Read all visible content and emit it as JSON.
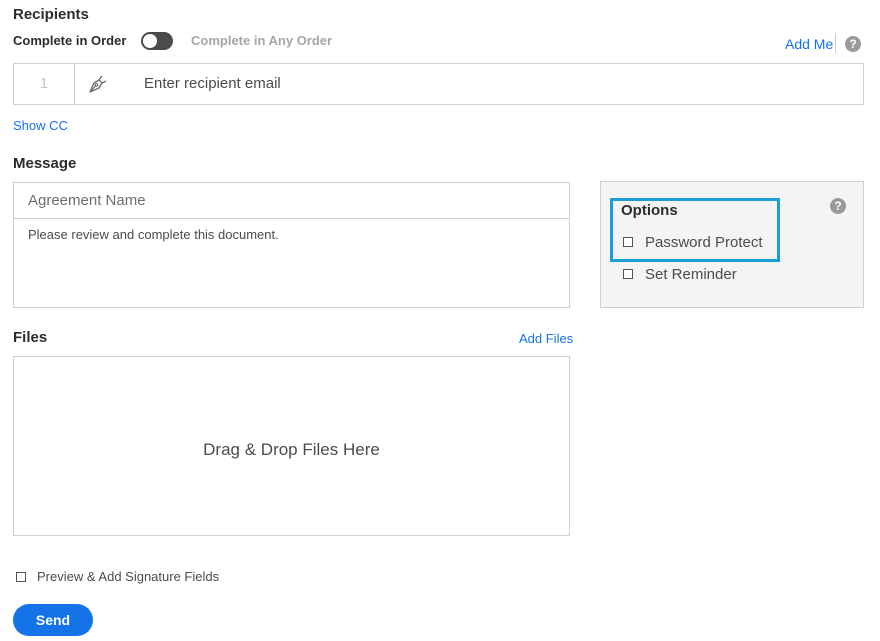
{
  "recipients": {
    "title": "Recipients",
    "complete_in_order": "Complete in Order",
    "complete_any_order": "Complete in Any Order",
    "add_me": "Add Me",
    "help_glyph": "?",
    "row_number": "1",
    "email_placeholder": "Enter recipient email",
    "show_cc": "Show CC"
  },
  "message": {
    "title": "Message",
    "agreement_name_placeholder": "Agreement Name",
    "body_text": "Please review and complete this document."
  },
  "options": {
    "title": "Options",
    "help_glyph": "?",
    "password_protect": "Password Protect",
    "set_reminder": "Set Reminder",
    "highlight_color": "#1a9ed8"
  },
  "files": {
    "title": "Files",
    "add_files": "Add Files",
    "drop_text": "Drag & Drop Files Here"
  },
  "footer": {
    "preview_label": "Preview & Add Signature Fields",
    "send_label": "Send"
  },
  "colors": {
    "accent": "#1473e6",
    "options_bg": "#f4f4f4"
  },
  "icons": {
    "signer": "pen-nib-icon",
    "help": "help-icon"
  }
}
